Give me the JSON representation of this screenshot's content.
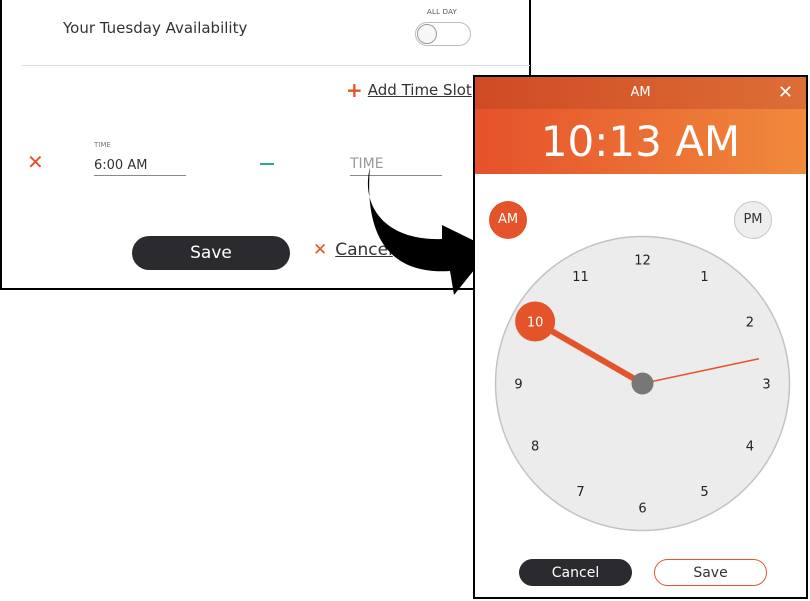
{
  "availability": {
    "title": "Your Tuesday Availability",
    "all_day_label": "ALL DAY",
    "all_day_on": false,
    "add_time_slot": "Add Time Slot",
    "slot": {
      "start_label": "TIME",
      "start_value": "6:00 AM",
      "end_placeholder": "TIME"
    },
    "save_label": "Save",
    "cancel_label": "Cancel",
    "icons": {
      "remove": "close-icon",
      "add": "plus-icon",
      "cancel": "close-icon"
    }
  },
  "picker": {
    "header_period": "AM",
    "display_time": "10:13 AM",
    "am_label": "AM",
    "pm_label": "PM",
    "selected_period": "AM",
    "hour": 10,
    "minute": 13,
    "hour_numbers": [
      "12",
      "1",
      "2",
      "3",
      "4",
      "5",
      "6",
      "7",
      "8",
      "9",
      "10",
      "11"
    ],
    "cancel_label": "Cancel",
    "save_label": "Save",
    "accent_color": "#e4532a"
  }
}
